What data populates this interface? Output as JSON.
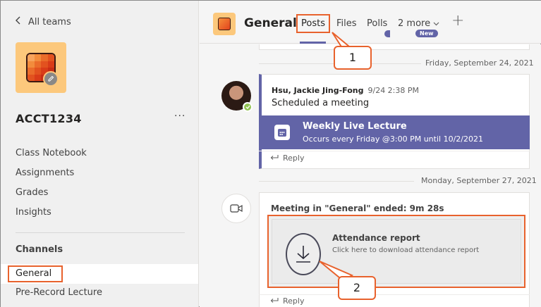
{
  "sidebar": {
    "back_label": "All teams",
    "team_name": "ACCT1234",
    "more_label": "···",
    "items": [
      {
        "label": "Class Notebook"
      },
      {
        "label": "Assignments"
      },
      {
        "label": "Grades"
      },
      {
        "label": "Insights"
      }
    ],
    "channels_header": "Channels",
    "channels": [
      {
        "label": "General"
      },
      {
        "label": "Pre-Record Lecture"
      }
    ]
  },
  "header": {
    "channel_title": "General",
    "tabs": [
      {
        "label": "Posts"
      },
      {
        "label": "Files"
      },
      {
        "label": "Polls"
      },
      {
        "label": "2 more"
      }
    ],
    "new_badge": "New",
    "add_tab": "+"
  },
  "feed": {
    "date1": "Friday, September 24, 2021",
    "message1": {
      "author": "Hsu, Jackie Jing-Fong",
      "time": "9/24 2:38 PM",
      "body": "Scheduled a meeting",
      "meeting_title": "Weekly Live Lecture",
      "meeting_sub": "Occurs every Friday @3:00 PM until 10/2/2021",
      "reply": "Reply"
    },
    "date2": "Monday, September 27, 2021",
    "message2": {
      "ended": "Meeting in \"General\" ended: 9m 28s",
      "report_title": "Attendance report",
      "report_sub": "Click here to download attendance report",
      "reply": "Reply"
    }
  },
  "callouts": {
    "one": "1",
    "two": "2"
  },
  "colors": {
    "accent": "#6264a7",
    "highlight": "#e8622d",
    "team_bg": "#fcc87c",
    "presence": "#92c353"
  }
}
